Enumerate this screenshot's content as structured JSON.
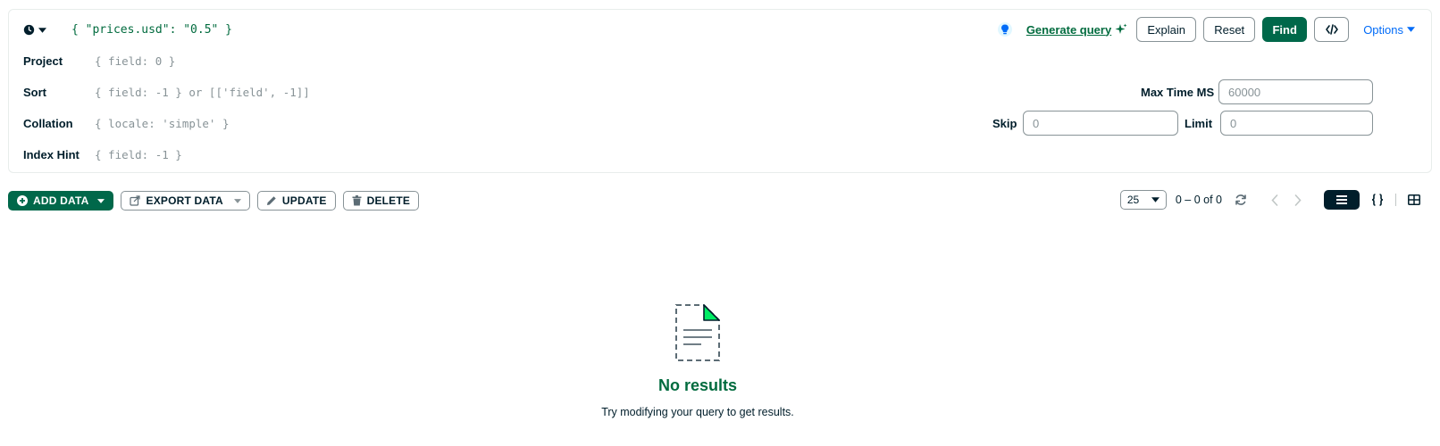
{
  "query": {
    "filter": "{ \"prices.usd\": \"0.5\" }",
    "rows": [
      {
        "label": "Project",
        "placeholder": "{ field: 0 }"
      },
      {
        "label": "Sort",
        "placeholder": "{ field: -1 } or [['field', -1]]"
      },
      {
        "label": "Collation",
        "placeholder": "{ locale: 'simple' }"
      },
      {
        "label": "Index Hint",
        "placeholder": "{ field: -1 }"
      }
    ],
    "generate_query": "Generate query",
    "explain": "Explain",
    "reset": "Reset",
    "find": "Find",
    "options": "Options",
    "max_time_label": "Max Time MS",
    "max_time_placeholder": "60000",
    "skip_label": "Skip",
    "skip_placeholder": "0",
    "limit_label": "Limit",
    "limit_placeholder": "0"
  },
  "toolbar": {
    "add_data": "ADD DATA",
    "export_data": "EXPORT DATA",
    "update": "UPDATE",
    "delete": "DELETE",
    "page_size": "25",
    "page_count": "0 – 0 of 0"
  },
  "empty": {
    "title": "No results",
    "subtitle": "Try modifying your query to get results."
  },
  "colors": {
    "brand_green": "#00684a",
    "text_green": "#016b3e",
    "link_blue": "#016bf8",
    "dark": "#001e2b",
    "placeholder": "#889397"
  }
}
